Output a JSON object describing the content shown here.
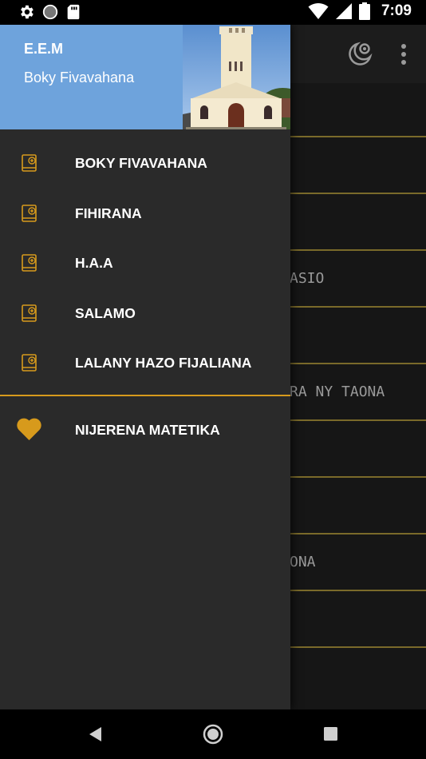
{
  "status_bar": {
    "time": "7:09",
    "left_icons": [
      "gear-icon",
      "circle-icon",
      "sd-card-icon"
    ],
    "right_icons": [
      "wifi-icon",
      "signal-icon",
      "battery-icon"
    ]
  },
  "app": {
    "toolbar_icons": [
      "night-mode-icon",
      "more-vert-icon"
    ],
    "rows": [
      "",
      "",
      "",
      "ASIO",
      "",
      "RA NY TAONA",
      "",
      "",
      "ONA",
      ""
    ]
  },
  "drawer": {
    "header": {
      "title": "E.E.M",
      "subtitle": "Boky Fivavahana",
      "header_color": "#6ea3dc"
    },
    "items": [
      {
        "label": "BOKY FIVAVAHANA",
        "icon": "book-add-icon"
      },
      {
        "label": "FIHIRANA",
        "icon": "book-add-icon"
      },
      {
        "label": "H.A.A",
        "icon": "book-add-icon"
      },
      {
        "label": "SALAMO",
        "icon": "book-add-icon"
      },
      {
        "label": "LALANY HAZO FIJALIANA",
        "icon": "book-add-icon"
      }
    ],
    "favorite": {
      "label": "NIJERENA MATETIKA",
      "icon": "heart-icon"
    },
    "accent_color": "#d79a1c"
  },
  "navbar": {
    "icons": [
      "back-icon",
      "home-icon",
      "recents-icon"
    ]
  }
}
